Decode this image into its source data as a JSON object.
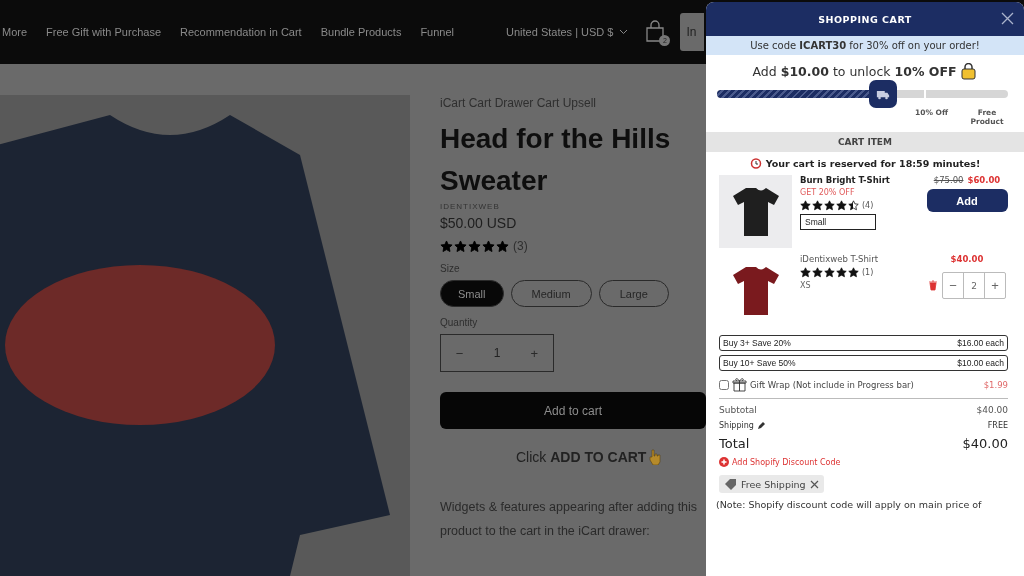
{
  "header": {
    "nav": [
      "More",
      "Free Gift with Purchase",
      "Recommendation in Cart",
      "Bundle Products",
      "Funnel"
    ],
    "locale": "United States | USD $",
    "cart_count": "2",
    "button": "In"
  },
  "product": {
    "eyebrow": "iCart Cart Drawer Cart Upsell",
    "title": "Head for the Hills Sweater",
    "vendor": "IDENTIXWEB",
    "price": "$50.00 USD",
    "stars": 5,
    "review_count": "(3)",
    "size_label": "Size",
    "sizes": [
      {
        "label": "Small",
        "selected": true
      },
      {
        "label": "Medium",
        "selected": false
      },
      {
        "label": "Large",
        "selected": false
      }
    ],
    "quantity_label": "Quantity",
    "quantity": "1",
    "minus": "−",
    "plus": "+",
    "add_button": "Add to cart",
    "hint": "Click **ADD TO CART**",
    "description": "Widgets & features appearing after adding this product to the cart in the iCart drawer:"
  },
  "cart": {
    "title": "SHOPPING CART",
    "promo": "Use code **ICART30** for 30% off on your order!",
    "unlock": "Add **$10.00** to unlock **10% OFF**",
    "level": 0.57,
    "milestones": [
      "10% Off",
      "Free Product"
    ],
    "section": "CART ITEM",
    "timer": "Your cart is reserved for 18:59 minutes!",
    "items": [
      {
        "kind": "upsell",
        "name": "Burn Bright T-Shirt",
        "offer": "GET 20% OFF",
        "stars": 4.5,
        "reviews": "(4)",
        "variant": "Small",
        "old_price": "$75.00",
        "price": "$60.00",
        "button": "Add",
        "color": "#1f1f1f"
      },
      {
        "kind": "line",
        "name": "iDentixweb T-Shirt",
        "stars": 5,
        "reviews": "(1)",
        "variant": "XS",
        "price": "$40.00",
        "quantity": "2",
        "minus": "−",
        "plus": "+",
        "color": "#7a1a1e"
      }
    ],
    "tiers": [
      {
        "label": "Buy 3+ Save 20%",
        "price": "$16.00 each"
      },
      {
        "label": "Buy 10+ Save 50%",
        "price": "$10.00 each"
      }
    ],
    "gift_wrap": {
      "label": "Gift Wrap (Not include in Progress bar)",
      "price": "$1.99",
      "checked": false
    },
    "subtotal": {
      "label": "Subtotal",
      "value": "$40.00"
    },
    "shipping": {
      "label": "Shipping",
      "value": "FREE"
    },
    "total": {
      "label": "Total",
      "value": "$40.00"
    },
    "discount_link": "Add Shopify Discount Code",
    "discount_tag": "Free Shipping",
    "note": "(Note: Shopify discount code will apply on main price of"
  }
}
